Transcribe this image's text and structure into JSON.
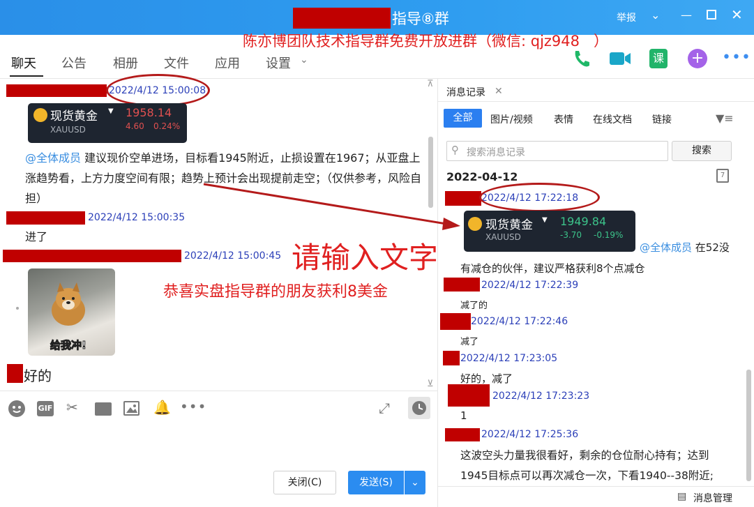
{
  "window": {
    "title": "指导⑧群",
    "report_label": "举报",
    "promo_text": "陈亦博团队技术指导群免费开放进群（微信: qjz948   ）"
  },
  "nav": {
    "tabs": [
      "聊天",
      "公告",
      "相册",
      "文件",
      "应用",
      "设置"
    ],
    "active": "聊天"
  },
  "chat": {
    "messages": [
      {
        "time": "2022/4/12 15:00:08"
      },
      {
        "time": "2022/4/12 15:00:35",
        "text": "进了"
      },
      {
        "time": "2022/4/12 15:00:45"
      }
    ],
    "gold_card": {
      "name": "现货黄金",
      "code": "XAUUSD",
      "price": "1958.14",
      "change": "4.60",
      "pct": "0.24%"
    },
    "announce_mention": "@全体成员",
    "announce_text": " 建议现价空单进场，目标看1945附近，止损设置在1967；从亚盘上涨趋势看，上方力度空间有限；趋势上预计会出现提前走空；（仅供参考，风险自担）",
    "sticker_caption": "给我冲!",
    "last_text": "好的",
    "overlay_input_hint": "请输入文字",
    "overlay_congrats": "恭喜实盘指导群的朋友获利8美金"
  },
  "toolbar": {
    "close_label": "关闭(C)",
    "send_label": "发送(S)"
  },
  "history": {
    "panel_title": "消息记录",
    "tabs": [
      "全部",
      "图片/视频",
      "表情",
      "在线文档",
      "链接"
    ],
    "search_placeholder": "搜索消息记录",
    "search_button": "搜索",
    "date": "2022-04-12",
    "gold_card": {
      "name": "现货黄金",
      "code": "XAUUSD",
      "price": "1949.84",
      "change": "-3.70",
      "pct": "-0.19%"
    },
    "mention": "@全体成员",
    "mention_text": " 在52没",
    "mention_text2": "有减仓的伙伴，建议严格获利8个点减仓",
    "messages": [
      {
        "time": "2022/4/12 17:22:18"
      },
      {
        "time": "2022/4/12 17:22:39",
        "text": "减了的"
      },
      {
        "time": "2022/4/12 17:22:46",
        "text": "减了"
      },
      {
        "time": "2022/4/12 17:23:05",
        "text": "好的，减了"
      },
      {
        "time": "2022/4/12 17:23:23",
        "text": "1"
      },
      {
        "time": "2022/4/12 17:25:36",
        "text": "这波空头力量我很看好，剩余的仓位耐心持有；达到"
      }
    ],
    "last_line": "1945目标点可以再次减仓一次，下看1940--38附近;",
    "manage_label": "消息管理"
  },
  "colors": {
    "accent": "#2b7ff0",
    "titlebar": "#2f9df0",
    "up": "#e05050",
    "down": "#3cc38a",
    "annotation": "#e02020"
  }
}
